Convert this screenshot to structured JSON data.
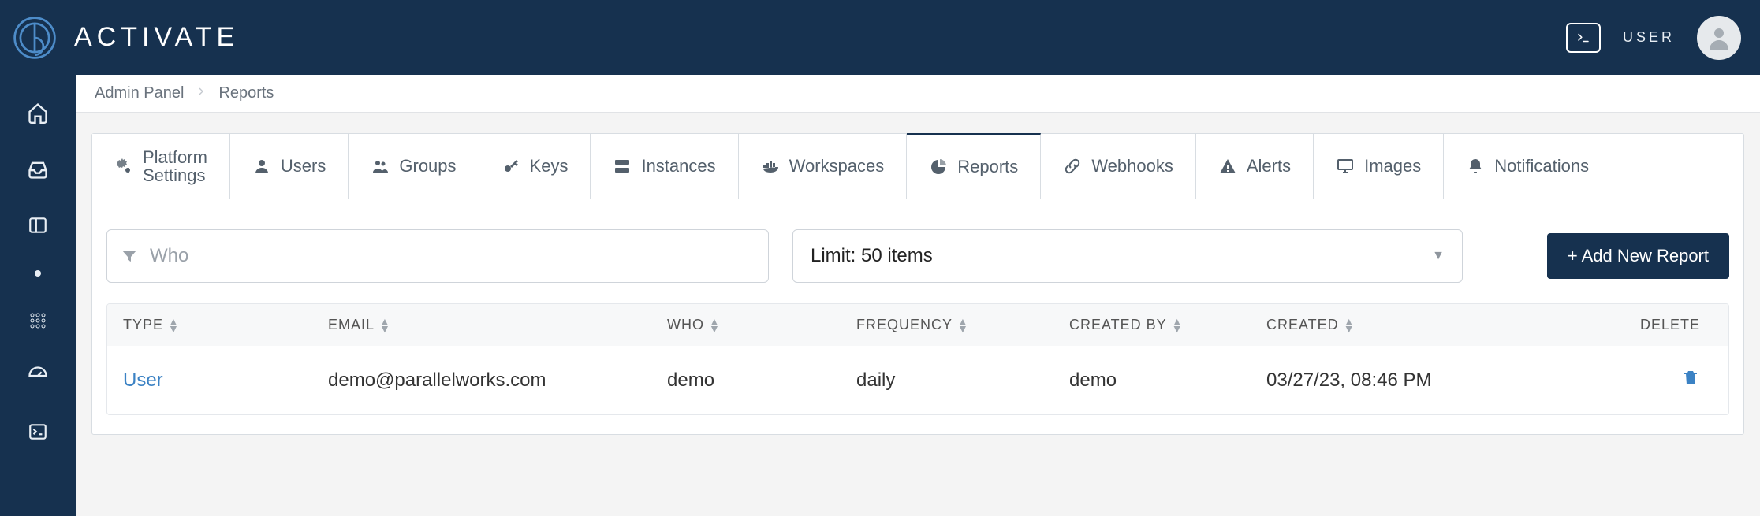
{
  "brand": "ACTIVATE",
  "header": {
    "user_label": "USER"
  },
  "breadcrumb": {
    "root": "Admin Panel",
    "current": "Reports"
  },
  "tabs": [
    {
      "id": "platform-settings",
      "label_line1": "Platform",
      "label_line2": "Settings",
      "icon": "gears"
    },
    {
      "id": "users",
      "label": "Users",
      "icon": "user"
    },
    {
      "id": "groups",
      "label": "Groups",
      "icon": "group"
    },
    {
      "id": "keys",
      "label": "Keys",
      "icon": "key"
    },
    {
      "id": "instances",
      "label": "Instances",
      "icon": "server"
    },
    {
      "id": "workspaces",
      "label": "Workspaces",
      "icon": "container"
    },
    {
      "id": "reports",
      "label": "Reports",
      "icon": "pie",
      "active": true
    },
    {
      "id": "webhooks",
      "label": "Webhooks",
      "icon": "link"
    },
    {
      "id": "alerts",
      "label": "Alerts",
      "icon": "warning"
    },
    {
      "id": "images",
      "label": "Images",
      "icon": "monitor"
    },
    {
      "id": "notifications",
      "label": "Notifications",
      "icon": "bell"
    }
  ],
  "filters": {
    "who_placeholder": "Who",
    "limit_label": "Limit: 50 items",
    "add_button": "+ Add New Report"
  },
  "table": {
    "columns": {
      "type": "TYPE",
      "email": "EMAIL",
      "who": "WHO",
      "frequency": "FREQUENCY",
      "created_by": "CREATED BY",
      "created": "CREATED",
      "delete": "DELETE"
    },
    "rows": [
      {
        "type": "User",
        "email": "demo@parallelworks.com",
        "who": "demo",
        "frequency": "daily",
        "created_by": "demo",
        "created": "03/27/23, 08:46 PM"
      }
    ]
  }
}
